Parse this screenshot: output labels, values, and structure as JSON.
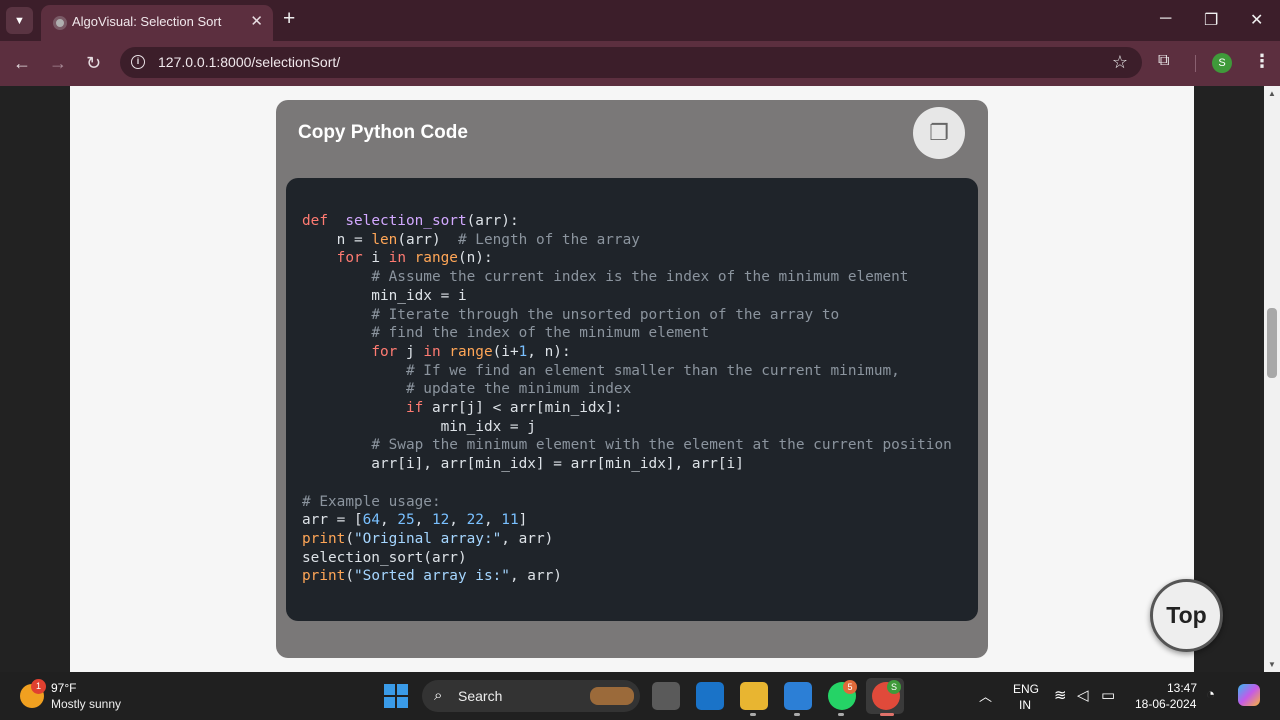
{
  "browser": {
    "tab_title": "AlgoVisual: Selection Sort",
    "url": "127.0.0.1:8000/selectionSort/",
    "profile_initial": "S"
  },
  "card": {
    "title": "Copy Python Code"
  },
  "code_lines": [
    [
      [
        "kw",
        "def"
      ],
      [
        "",
        "  "
      ],
      [
        "fn",
        "selection_sort"
      ],
      [
        "",
        "(arr):"
      ]
    ],
    [
      [
        "",
        "    n = "
      ],
      [
        "bi",
        "len"
      ],
      [
        "",
        "(arr)  "
      ],
      [
        "cm",
        "# Length of the array"
      ]
    ],
    [
      [
        "",
        "    "
      ],
      [
        "kw",
        "for"
      ],
      [
        "",
        " i "
      ],
      [
        "kw",
        "in"
      ],
      [
        "",
        ""
      ],
      [
        "bi",
        " range"
      ],
      [
        "",
        "(n):"
      ]
    ],
    [
      [
        "",
        "        "
      ],
      [
        "cm",
        "# Assume the current index is the index of the minimum element"
      ]
    ],
    [
      [
        "",
        "        min_idx = i"
      ]
    ],
    [
      [
        "",
        "        "
      ],
      [
        "cm",
        "# Iterate through the unsorted portion of the array to"
      ]
    ],
    [
      [
        "",
        "        "
      ],
      [
        "cm",
        "# find the index of the minimum element"
      ]
    ],
    [
      [
        "",
        "        "
      ],
      [
        "kw",
        "for"
      ],
      [
        "",
        " j "
      ],
      [
        "kw",
        "in"
      ],
      [
        "bi",
        " range"
      ],
      [
        "",
        "(i+"
      ],
      [
        "num",
        "1"
      ],
      [
        "",
        ", n):"
      ]
    ],
    [
      [
        "",
        "            "
      ],
      [
        "cm",
        "# If we find an element smaller than the current minimum,"
      ]
    ],
    [
      [
        "",
        "            "
      ],
      [
        "cm",
        "# update the minimum index"
      ]
    ],
    [
      [
        "",
        "            "
      ],
      [
        "kw",
        "if"
      ],
      [
        "",
        " arr[j] < arr[min_idx]:"
      ]
    ],
    [
      [
        "",
        "                min_idx = j"
      ]
    ],
    [
      [
        "",
        "        "
      ],
      [
        "cm",
        "# Swap the minimum element with the element at the current position"
      ]
    ],
    [
      [
        "",
        "        arr[i], arr[min_idx] = arr[min_idx], arr[i]"
      ]
    ],
    [
      [
        "",
        ""
      ]
    ],
    [
      [
        "cm",
        "# Example usage:"
      ]
    ],
    [
      [
        "",
        "arr = ["
      ],
      [
        "num",
        "64"
      ],
      [
        "",
        ", "
      ],
      [
        "num",
        "25"
      ],
      [
        "",
        ", "
      ],
      [
        "num",
        "12"
      ],
      [
        "",
        ", "
      ],
      [
        "num",
        "22"
      ],
      [
        "",
        ", "
      ],
      [
        "num",
        "11"
      ],
      [
        "",
        "]"
      ]
    ],
    [
      [
        "bi",
        "print"
      ],
      [
        "",
        "("
      ],
      [
        "str",
        "\"Original array:\""
      ],
      [
        "",
        ", arr)"
      ]
    ],
    [
      [
        "",
        "selection_sort(arr)"
      ]
    ],
    [
      [
        "bi",
        "print"
      ],
      [
        "",
        "("
      ],
      [
        "str",
        "\"Sorted array is:\""
      ],
      [
        "",
        ", arr)"
      ]
    ]
  ],
  "top_button": "Top",
  "taskbar": {
    "weather_temp": "97°F",
    "weather_desc": "Mostly sunny",
    "weather_badge": "1",
    "search_label": "Search",
    "whatsapp_badge": "5",
    "chrome_badge": "S",
    "lang_top": "ENG",
    "lang_bottom": "IN",
    "time": "13:47",
    "date": "18-06-2024"
  },
  "colors": {
    "tab_bar": "#3c1e2a",
    "toolbar": "#5c2f3f",
    "card": "#7a7878",
    "code_bg": "#1f242a"
  }
}
